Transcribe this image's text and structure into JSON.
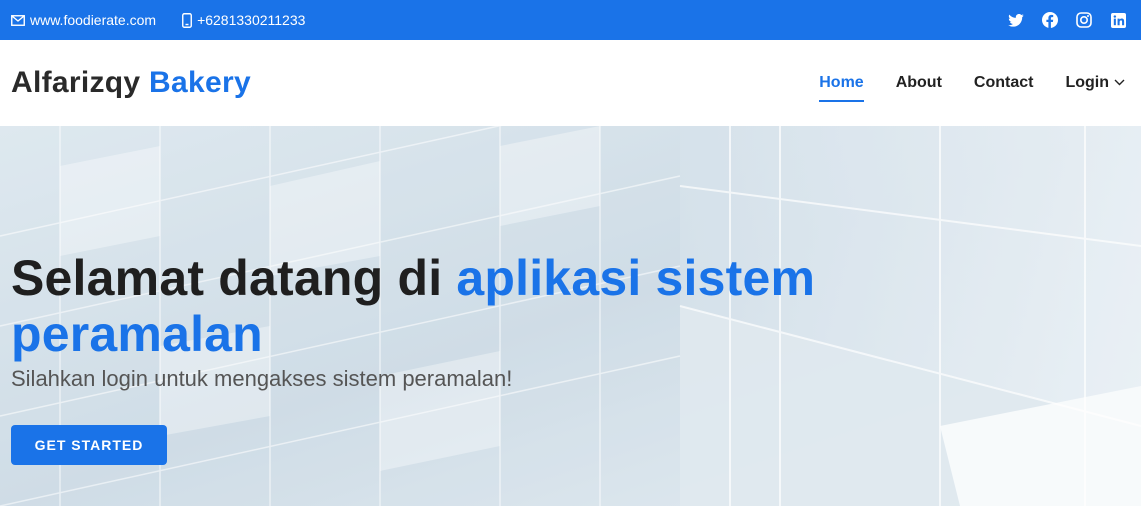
{
  "topbar": {
    "website": "www.foodierate.com",
    "phone": "+6281330211233",
    "social_icons": [
      "twitter-icon",
      "facebook-icon",
      "instagram-icon",
      "linkedin-icon"
    ]
  },
  "header": {
    "brand_part1": "Alfarizqy",
    "brand_part2": "Bakery",
    "nav": {
      "home": "Home",
      "about": "About",
      "contact": "Contact",
      "login": "Login"
    }
  },
  "hero": {
    "title_part1": "Selamat datang di",
    "title_part2": "aplikasi sistem peramalan",
    "subtitle": "Silahkan login untuk mengakses sistem peramalan!",
    "cta": "GET STARTED"
  },
  "colors": {
    "primary": "#1a73e8",
    "text_dark": "#1f1f1f"
  }
}
